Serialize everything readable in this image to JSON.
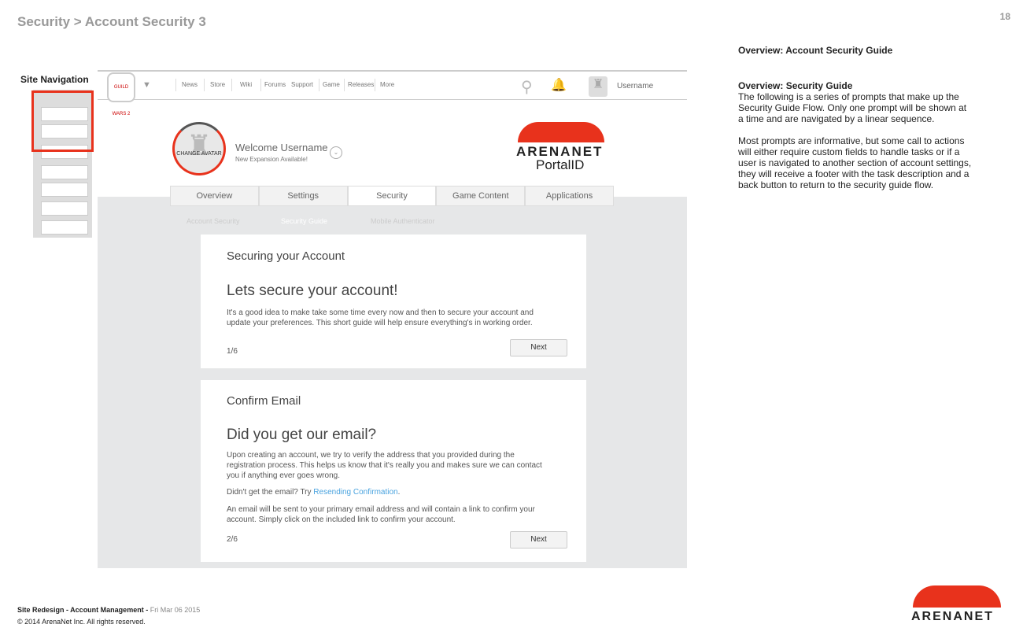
{
  "slide": {
    "title": "Security > Account Security 3",
    "page_number": "18",
    "nav_label": "Site Navigation"
  },
  "header": {
    "logo_text": "GUILD WARS 2",
    "nav": [
      "News",
      "Store",
      "Wiki",
      "Forums",
      "Support",
      "Game",
      "Releases",
      "More"
    ],
    "username": "Username"
  },
  "profile": {
    "avatar_label": "CHANGE AVATAR",
    "welcome": "Welcome Username",
    "subtitle": "New Expansion Available!",
    "brand": "ARENANET",
    "brand_sub": "PortalID"
  },
  "tabs": [
    "Overview",
    "Settings",
    "Security",
    "Game Content",
    "Applications"
  ],
  "active_tab": "Security",
  "subtabs": [
    "Account Security",
    "Security Guide",
    "Mobile Authenticator"
  ],
  "cards": [
    {
      "section": "Securing your Account",
      "heading": "Lets secure your account!",
      "body": "It's a good idea to make take some time every now and then to secure your account and update your preferences.  This short guide will help ensure everything's in working order.",
      "step": "1/6",
      "button": "Next"
    },
    {
      "section": "Confirm Email",
      "heading": "Did you get our email?",
      "body": "Upon creating an account, we try to verify the address that you provided during the registration process.  This helps us know that it's really you and makes sure we can contact you if anything ever goes wrong.",
      "resend_prefix": "Didn't get the email? Try ",
      "resend_link": "Resending Confirmation",
      "resend_suffix": ".",
      "body2": "An email will be sent to your primary email address and will contain a link to confirm your account. Simply click on the included link to confirm your account.",
      "step": "2/6",
      "button": "Next"
    }
  ],
  "notes": {
    "title1": "Overview: Account Security Guide",
    "title2": "Overview: Security Guide",
    "p1": "The following is a series of prompts that make up the Security Guide Flow. Only one prompt will be shown at a time and are navigated by a linear sequence.",
    "p2": "Most prompts are informative, but some call to actions will either require custom fields to handle tasks or if a user is navigated to another section of account settings, they will receive a footer with the task description and a back button to return to the security guide flow."
  },
  "footer": {
    "project": "Site Redesign - Account Management - ",
    "date": "Fri Mar 06 2015",
    "copyright": "© 2014 ArenaNet Inc. All rights reserved.",
    "logo": "ARENANET"
  },
  "colors": {
    "accent": "#e8321c",
    "link": "#4aa3df"
  }
}
